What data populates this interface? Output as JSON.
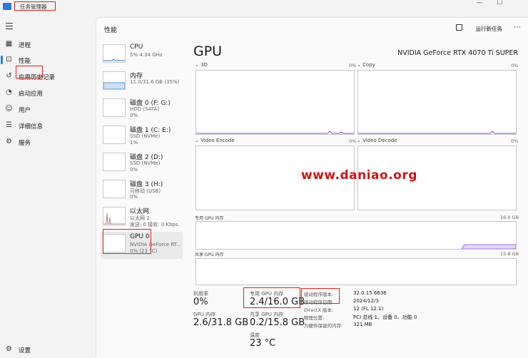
{
  "window": {
    "title": "任务管理器",
    "minimize": "—",
    "maximize": "☐"
  },
  "nav": {
    "items": [
      {
        "label": "进程",
        "icon": "processes-icon"
      },
      {
        "label": "性能",
        "icon": "performance-icon"
      },
      {
        "label": "应用历史记录",
        "icon": "app-history-icon"
      },
      {
        "label": "启动应用",
        "icon": "startup-apps-icon"
      },
      {
        "label": "用户",
        "icon": "users-icon"
      },
      {
        "label": "详细信息",
        "icon": "details-icon"
      },
      {
        "label": "服务",
        "icon": "services-icon"
      }
    ],
    "settings_label": "设置"
  },
  "header": {
    "title": "性能",
    "run_task_label": "运行新任务",
    "more": "⋯"
  },
  "devices": [
    {
      "name": "CPU",
      "sub1": "5% 4.34 GHz",
      "sub2": ""
    },
    {
      "name": "内存",
      "sub1": "11.0/31.6 GB (35%)",
      "sub2": ""
    },
    {
      "name": "磁盘 0 (F: G:)",
      "sub1": "HDD (SATA)",
      "sub2": "0%"
    },
    {
      "name": "磁盘 1 (C: E:)",
      "sub1": "SSD (NVMe)",
      "sub2": "1%"
    },
    {
      "name": "磁盘 2 (D:)",
      "sub1": "SSD (NVMe)",
      "sub2": "0%"
    },
    {
      "name": "磁盘 3 (H:)",
      "sub1": "可移动 (USB)",
      "sub2": "0%"
    },
    {
      "name": "以太网",
      "sub1": "以太网 2",
      "sub2": "发送: 0 接收: 0 Kbps"
    },
    {
      "name": "GPU 0",
      "sub1": "NVIDIA GeForce RT...",
      "sub2": "0% (23 °C)"
    }
  ],
  "gpu": {
    "title": "GPU",
    "model": "NVIDIA GeForce RTX 4070 Ti SUPER",
    "engines": [
      {
        "label": "3D",
        "pct": "0%"
      },
      {
        "label": "Copy",
        "pct": "0%"
      },
      {
        "label": "Video Encode",
        "pct": "0%"
      },
      {
        "label": "Video Decode",
        "pct": "0%"
      }
    ],
    "dedicated_graph": {
      "label": "专用 GPU 内存",
      "max": "16.0 GB"
    },
    "shared_graph": {
      "label": "共享 GPU 内存",
      "max": "15.8 GB"
    },
    "stats": {
      "utilization_label": "利用率",
      "utilization": "0%",
      "dedicated_label": "专用 GPU 内存",
      "dedicated": "2.4/16.0 GB",
      "gpu_mem_label": "GPU 内存",
      "gpu_mem": "2.6/31.8 GB",
      "shared_label": "共享 GPU 内存",
      "shared": "0.2/15.8 GB",
      "temp_label": "温度",
      "temp": "23 °C"
    },
    "info": [
      {
        "k": "驱动程序版本:",
        "v": "32.0.15.6636"
      },
      {
        "k": "驱动程序日期:",
        "v": "2024/12/3"
      },
      {
        "k": "DirectX 版本:",
        "v": "12 (FL 12.1)"
      },
      {
        "k": "物理位置:",
        "v": "PCI 总线 1、设备 0、功能 0"
      },
      {
        "k": "为硬件保留的内存:",
        "v": "321 MB"
      }
    ]
  },
  "watermark": "www.daniao.org",
  "colors": {
    "accent": "#2a7bd6",
    "gpu_line": "#8c4fd6",
    "highlight": "#e02020"
  }
}
